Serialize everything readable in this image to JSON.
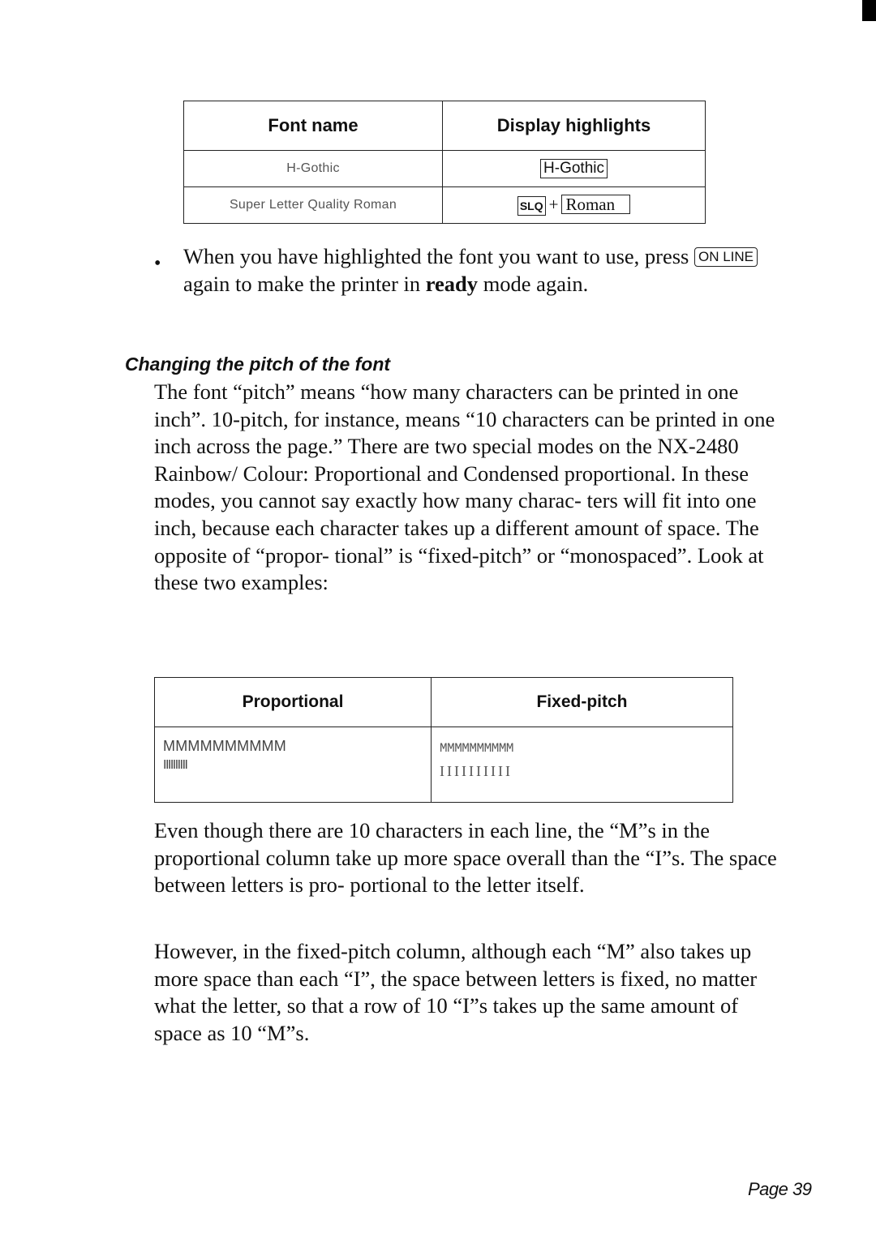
{
  "font_table": {
    "headers": [
      "Font name",
      "Display highlights"
    ],
    "rows": [
      {
        "font_name": "H-Gothic",
        "display": {
          "key": "H-Gothic"
        }
      },
      {
        "font_name": "Super Letter Quality Roman",
        "display": {
          "prefix_key": "SLQ",
          "plus": "+",
          "key": "Roman"
        }
      }
    ]
  },
  "bullet": {
    "symbol": "•",
    "text_before": "When you have highlighted the font you want to use, press ",
    "key": "ON LINE",
    "text_middle": " again to make the printer in ",
    "bold": "ready",
    "text_after": " mode again."
  },
  "section": {
    "heading": "Changing the pitch of the font",
    "paragraph1": "The font “pitch” means “how many characters can be printed in one inch”. 10-pitch, for instance, means “10 characters can be printed in one inch across the page.” There are two special modes on the NX-2480 Rainbow/ Colour: Proportional and Condensed proportional. In these modes, you cannot say exactly how many charac- ters will fit into one inch, because each character takes up a different amount of space. The opposite of “propor- tional” is “fixed-pitch” or “monospaced”. Look at these two examples:"
  },
  "pitch_table": {
    "headers": [
      "Proportional",
      "Fixed-pitch"
    ],
    "proportional": [
      "MMMMMMMMMM",
      "IIIIIIIIII"
    ],
    "fixed": [
      "MMMMMMMMMM",
      "IIIIIIIIII"
    ]
  },
  "paragraph2": "Even though there are 10 characters in each line, the “M”s in the proportional column take up more space overall than the “I”s. The space between letters is pro- portional to the letter itself.",
  "paragraph3": "However, in the fixed-pitch column, although each “M” also takes up more space than each “I”, the space between letters is fixed, no matter what the letter, so that a row of 10 “I”s takes up the same amount of space as 10 “M”s.",
  "footer": {
    "page_label": "Page 39"
  }
}
